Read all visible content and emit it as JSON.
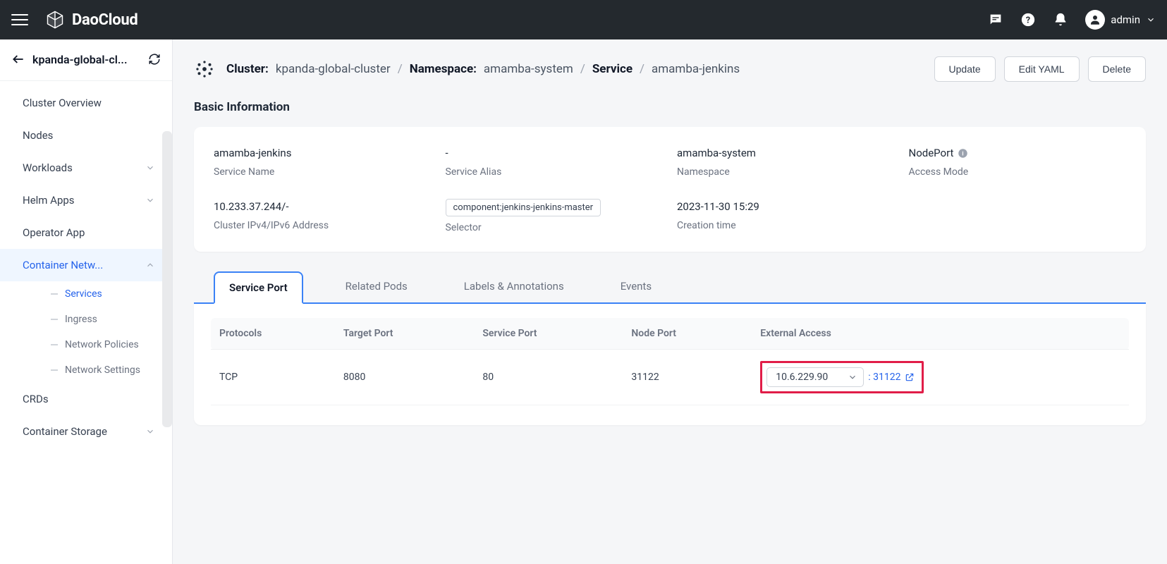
{
  "header": {
    "brand": "DaoCloud",
    "user": "admin"
  },
  "sidebar": {
    "title": "kpanda-global-cl...",
    "items": [
      {
        "label": "Cluster Overview",
        "expandable": false
      },
      {
        "label": "Nodes",
        "expandable": false
      },
      {
        "label": "Workloads",
        "expandable": true
      },
      {
        "label": "Helm Apps",
        "expandable": true
      },
      {
        "label": "Operator App",
        "expandable": false
      },
      {
        "label": "Container Netw...",
        "expandable": true,
        "active": true,
        "open": true
      },
      {
        "label": "CRDs",
        "expandable": false
      },
      {
        "label": "Container Storage",
        "expandable": true
      }
    ],
    "networkSub": [
      {
        "label": "Services",
        "active": true
      },
      {
        "label": "Ingress"
      },
      {
        "label": "Network Policies"
      },
      {
        "label": "Network Settings"
      }
    ]
  },
  "breadcrumb": {
    "cluster_label": "Cluster:",
    "cluster_val": "kpanda-global-cluster",
    "ns_label": "Namespace:",
    "ns_val": "amamba-system",
    "service_label": "Service",
    "service_val": "amamba-jenkins"
  },
  "actions": {
    "update": "Update",
    "edit_yaml": "Edit YAML",
    "delete": "Delete"
  },
  "basic": {
    "title": "Basic Information",
    "fields": {
      "service_name": {
        "value": "amamba-jenkins",
        "label": "Service Name"
      },
      "service_alias": {
        "value": "-",
        "label": "Service Alias"
      },
      "namespace": {
        "value": "amamba-system",
        "label": "Namespace"
      },
      "access_mode": {
        "value": "NodePort",
        "label": "Access Mode"
      },
      "cluster_ip": {
        "value": "10.233.37.244/-",
        "label": "Cluster IPv4/IPv6 Address"
      },
      "selector": {
        "value": "component:jenkins-jenkins-master",
        "label": "Selector"
      },
      "creation_time": {
        "value": "2023-11-30 15:29",
        "label": "Creation time"
      }
    }
  },
  "tabs": [
    {
      "label": "Service Port",
      "active": true
    },
    {
      "label": "Related Pods"
    },
    {
      "label": "Labels & Annotations"
    },
    {
      "label": "Events"
    }
  ],
  "table": {
    "headers": {
      "protocols": "Protocols",
      "target_port": "Target Port",
      "service_port": "Service Port",
      "node_port": "Node Port",
      "external_access": "External Access"
    },
    "rows": [
      {
        "protocol": "TCP",
        "target_port": "8080",
        "service_port": "80",
        "node_port": "31122",
        "ext_ip": "10.6.229.90",
        "ext_port": ": 31122"
      }
    ]
  }
}
